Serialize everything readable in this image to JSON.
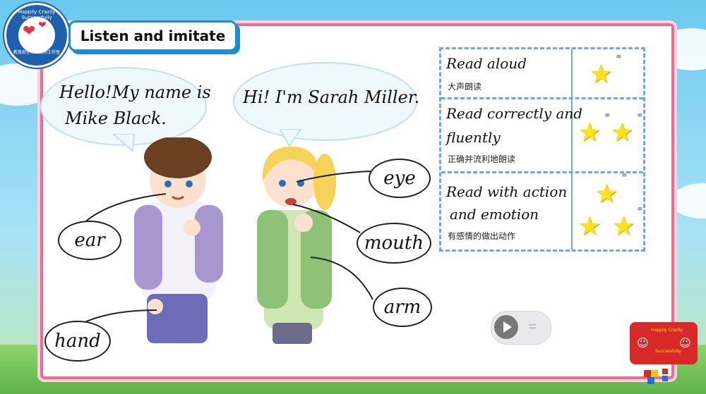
{
  "slide": {
    "title": "Listen and imitate",
    "logo": {
      "ring_text": "Happily Crazily Successfully",
      "bottom_text": "教育部全小玲名师工作室",
      "icon": "heart-envelope-icon"
    }
  },
  "dialogue": {
    "boy_bubble_line1": "Hello!My name is",
    "boy_bubble_line2": "Mike Black.",
    "girl_bubble": "Hi! I'm Sarah Miller."
  },
  "labels": {
    "ear": "ear",
    "hand": "hand",
    "eye": "eye",
    "mouth": "mouth",
    "arm": "arm"
  },
  "rubric": {
    "rows": [
      {
        "en_line1": "Read aloud",
        "en_line2": "",
        "zh": "大声朗读",
        "stars": 1
      },
      {
        "en_line1": "Read correctly and",
        "en_line2": "fluently",
        "zh": "正确并流利地朗读",
        "stars": 2
      },
      {
        "en_line1": "Read with action",
        "en_line2": "and emotion",
        "zh": "有感情的做出动作",
        "stars": 3
      }
    ]
  },
  "player": {
    "play_icon": "play-icon",
    "settings_icon": "equalizer-icon"
  },
  "brand": {
    "line1": "Happily Crazily",
    "line2": "Successfully"
  },
  "colors": {
    "board_border": "#f06b8e",
    "title_border": "#1e8bd6",
    "rubric_border": "#6ea8e8",
    "star": "#ffe21a"
  }
}
